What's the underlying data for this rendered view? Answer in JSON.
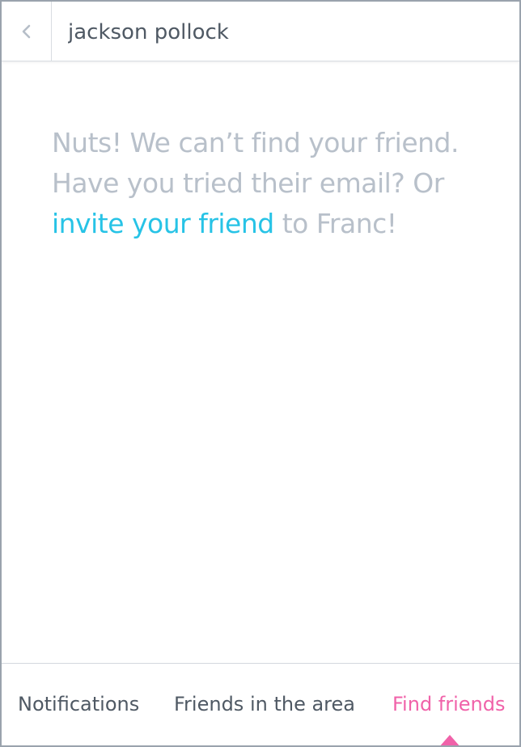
{
  "header": {
    "search_value": "jackson pollock",
    "back_icon": "chevron-left-icon"
  },
  "message": {
    "line_prefix": "Nuts! We can’t find your friend. Have you tried their email? Or ",
    "invite_link": "invite your friend",
    "line_suffix": " to Franc!"
  },
  "tabs": [
    {
      "label": "Notifications",
      "active": false
    },
    {
      "label": "Friends in the area",
      "active": false
    },
    {
      "label": "Find friends",
      "active": true
    }
  ],
  "colors": {
    "accent_link": "#27c3e6",
    "active_tab": "#f062a9",
    "muted_text": "#b8c0ca",
    "body_text": "#4f5964"
  }
}
